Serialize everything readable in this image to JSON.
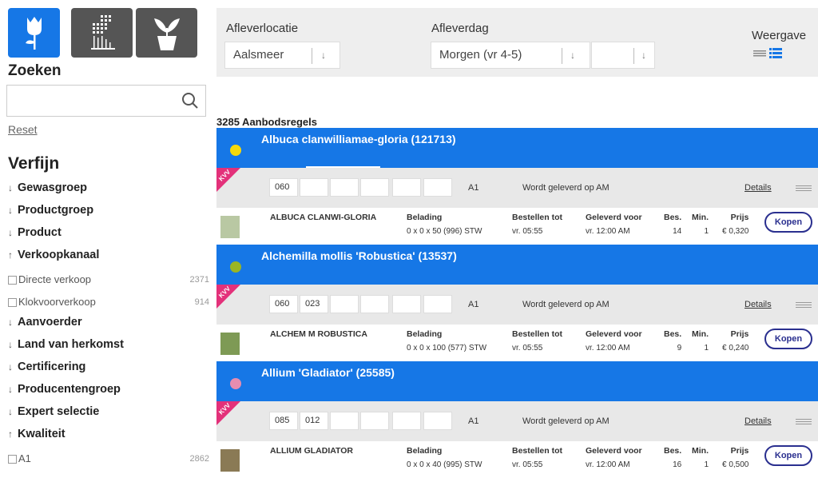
{
  "sidebar": {
    "category_buttons": [
      {
        "icon": "flower-icon",
        "active": true
      },
      {
        "icon": "greenhouse-icon",
        "active": false
      },
      {
        "icon": "potted-plant-icon",
        "active": false
      }
    ],
    "search_title": "Zoeken",
    "search_placeholder": "",
    "reset_label": "Reset",
    "refine_title": "Verfijn",
    "filters": [
      {
        "label": "Gewasgroep",
        "expanded": false
      },
      {
        "label": "Productgroep",
        "expanded": false
      },
      {
        "label": "Product",
        "expanded": false
      },
      {
        "label": "Verkoopkanaal",
        "expanded": true,
        "options": [
          {
            "label": "Directe verkoop",
            "count": "2371"
          },
          {
            "label": "Klokvoorverkoop",
            "count": "914"
          }
        ]
      },
      {
        "label": "Aanvoerder",
        "expanded": false
      },
      {
        "label": "Land van herkomst",
        "expanded": false
      },
      {
        "label": "Certificering",
        "expanded": false
      },
      {
        "label": "Producentengroep",
        "expanded": false
      },
      {
        "label": "Expert selectie",
        "expanded": false
      },
      {
        "label": "Kwaliteit",
        "expanded": true,
        "options": [
          {
            "label": "A1",
            "count": "2862"
          }
        ]
      }
    ]
  },
  "topbar": {
    "location_label": "Afleverlocatie",
    "location_value": "Aalsmeer",
    "day_label": "Afleverdag",
    "day_value": "Morgen (vr 4-5)",
    "day_extra_value": "",
    "view_label": "Weergave"
  },
  "results": {
    "count_label": "3285 Aanbodsregels",
    "items": [
      {
        "title": "Albuca clanwilliamae-gloria (121713)",
        "dot_color": "#f5d90a",
        "badge": "KVV",
        "codes": [
          "060",
          "",
          "",
          "",
          "",
          ""
        ],
        "grade": "A1",
        "delivery": "Wordt geleverd op  AM",
        "details": "Details",
        "name": "ALBUCA CLANWI-GLORIA",
        "belading_label": "Belading",
        "belading": "0 x 0 x 50 (996) STW",
        "bestellen_label": "Bestellen tot",
        "bestellen": "vr. 05:55",
        "geleverd_label": "Geleverd voor",
        "geleverd": "vr. 12:00    AM",
        "bes_label": "Bes.",
        "bes": "14",
        "min_label": "Min.",
        "min": "1",
        "prijs_label": "Prijs",
        "prijs": "€ 0,320",
        "buy_label": "Kopen"
      },
      {
        "title": "Alchemilla mollis 'Robustica' (13537)",
        "dot_color": "#9ab524",
        "badge": "KVV",
        "codes": [
          "060",
          "023",
          "",
          "",
          "",
          ""
        ],
        "grade": "A1",
        "delivery": "Wordt geleverd op  AM",
        "details": "Details",
        "name": "ALCHEM M ROBUSTICA",
        "belading_label": "Belading",
        "belading": "0 x 0 x 100 (577) STW",
        "bestellen_label": "Bestellen tot",
        "bestellen": "vr. 05:55",
        "geleverd_label": "Geleverd voor",
        "geleverd": "vr. 12:00    AM",
        "bes_label": "Bes.",
        "bes": "9",
        "min_label": "Min.",
        "min": "1",
        "prijs_label": "Prijs",
        "prijs": "€ 0,240",
        "buy_label": "Kopen"
      },
      {
        "title": "Allium 'Gladiator' (25585)",
        "dot_color": "#e78db0",
        "badge": "KVV",
        "codes": [
          "085",
          "012",
          "",
          "",
          "",
          ""
        ],
        "grade": "A1",
        "delivery": "Wordt geleverd op  AM",
        "details": "Details",
        "name": "ALLIUM GLADIATOR",
        "belading_label": "Belading",
        "belading": "0 x 0 x 40 (995) STW",
        "bestellen_label": "Bestellen tot",
        "bestellen": "vr. 05:55",
        "geleverd_label": "Geleverd voor",
        "geleverd": "vr. 12:00    AM",
        "bes_label": "Bes.",
        "bes": "16",
        "min_label": "Min.",
        "min": "1",
        "prijs_label": "Prijs",
        "prijs": "€ 0,500",
        "buy_label": "Kopen"
      }
    ]
  },
  "colors": {
    "accent": "#1677e6",
    "badge": "#e3317a",
    "dark_tile": "#555555",
    "buy": "#2a2f8f"
  }
}
